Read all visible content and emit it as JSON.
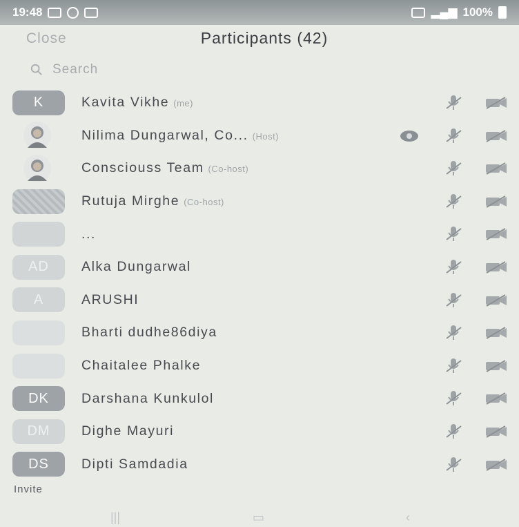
{
  "status_bar": {
    "time": "19:48",
    "battery": "100%"
  },
  "header": {
    "close_label": "Close",
    "title": "Participants (42)"
  },
  "search": {
    "placeholder": "Search"
  },
  "participants": [
    {
      "avatar": "K",
      "avatar_style": "dark",
      "name": "Kavita  Vikhe",
      "tag": "(me)"
    },
    {
      "avatar": "",
      "avatar_style": "photo",
      "name": "Nilima Dungarwal, Co...",
      "tag": "(Host)",
      "screen_share": true
    },
    {
      "avatar": "",
      "avatar_style": "photo",
      "name": "Consciouss Team",
      "tag": "(Co-host)"
    },
    {
      "avatar": "",
      "avatar_style": "pattern",
      "name": "Rutuja Mirghe",
      "tag": "(Co-host)"
    },
    {
      "avatar": "",
      "avatar_style": "light",
      "name": "...",
      "tag": ""
    },
    {
      "avatar": "AD",
      "avatar_style": "light",
      "name": "Alka Dungarwal",
      "tag": ""
    },
    {
      "avatar": "A",
      "avatar_style": "light",
      "name": "ARUSHI",
      "tag": ""
    },
    {
      "avatar": "",
      "avatar_style": "faint",
      "name": "Bharti  dudhe86diya",
      "tag": ""
    },
    {
      "avatar": "",
      "avatar_style": "faint",
      "name": "Chaitalee Phalke",
      "tag": ""
    },
    {
      "avatar": "DK",
      "avatar_style": "dark",
      "name": "Darshana Kunkulol",
      "tag": ""
    },
    {
      "avatar": "DM",
      "avatar_style": "light",
      "name": "Dighe Mayuri",
      "tag": ""
    },
    {
      "avatar": "DS",
      "avatar_style": "dark",
      "name": "Dipti Samdadia",
      "tag": ""
    }
  ],
  "footer": {
    "invite_label": "Invite"
  },
  "icons": {
    "mic": "mic-muted-icon",
    "camera": "video-off-icon",
    "search": "search-icon",
    "screen_share": "screen-share-icon"
  }
}
